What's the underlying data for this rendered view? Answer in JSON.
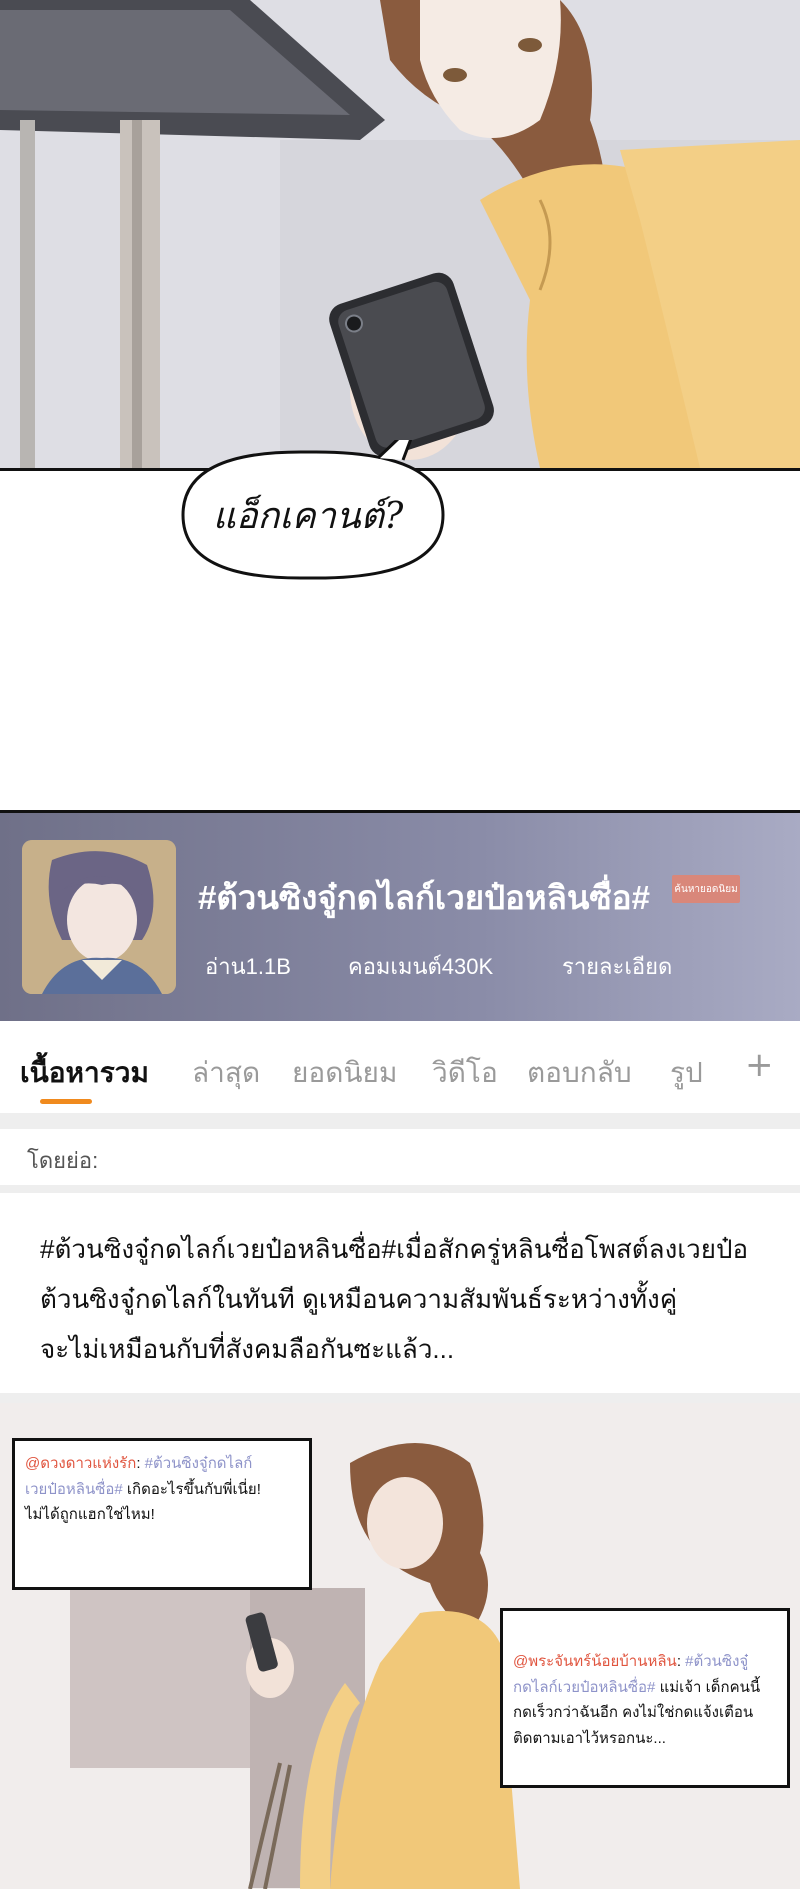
{
  "comic": {
    "speech_bubble": "แอ็กเคานต์?"
  },
  "topic": {
    "title": "#ต้วนซิงจู๋กดไลก์เวยป๋อหลินซื่อ#",
    "badge": "ค้นหายอดนิยม",
    "reads": "อ่าน1.1B",
    "comments": "คอมเมนต์430K",
    "details": "รายละเอียด"
  },
  "tabs": [
    {
      "label": "เนื้อหารวม",
      "active": true
    },
    {
      "label": "ล่าสุด"
    },
    {
      "label": "ยอดนิยม"
    },
    {
      "label": "วิดีโอ"
    },
    {
      "label": "ตอบกลับ"
    },
    {
      "label": "รูป"
    }
  ],
  "tab_add_icon": "+",
  "summary": {
    "label": "โดยย่อ:",
    "lines": [
      "#ต้วนซิงจู๋กดไลก์เวยป๋อหลินซื่อ#เมื่อสักครู่หลินซื่อโพสต์ลงเวยป๋อ",
      "ต้วนซิงจู๋กดไลก์ในทันที ดูเหมือนความสัมพันธ์ระหว่างทั้งคู่",
      "จะไม่เหมือนกับที่สังคมลือกันซะแล้ว..."
    ]
  },
  "comments": [
    {
      "user": "@ดวงดาวแห่งรัก",
      "tag_a": "#ต้วนซิงจู๋กดไลก์",
      "tag_b": "เวยป๋อหลินซื่อ#",
      "text_a": "เกิดอะไรขึ้นกับพี่เนี่ย!",
      "text_b": "ไม่ได้ถูกแฮกใช่ไหม!"
    },
    {
      "user": "@พระจันทร์น้อยบ้านหลิน",
      "tag_a": "#ต้วนซิงจู๋",
      "tag_b": "กดไลก์เวยป๋อหลินซื่อ#",
      "text_a": "แม่เจ้า เด็กคนนี้",
      "text_b": "กดเร็วกว่าฉันอีก คงไม่ใช่กดแจ้งเตือน",
      "text_c": "ติดตามเอาไว้หรอกนะ..."
    }
  ],
  "colors": {
    "accent": "#f08a1e",
    "username": "#e0553f",
    "hashtag": "#8e93c9",
    "topic_bg": "#8a8ca8"
  }
}
